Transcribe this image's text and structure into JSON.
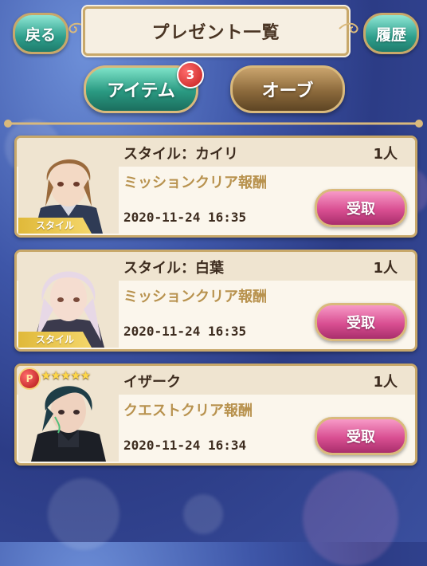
{
  "header": {
    "back_label": "戻る",
    "title": "プレゼント一覧",
    "history_label": "履歴"
  },
  "tabs": [
    {
      "label": "アイテム",
      "badge": "3",
      "active": true
    },
    {
      "label": "オーブ",
      "active": false
    }
  ],
  "presents": [
    {
      "name": "スタイル：カイリ",
      "quantity": "1人",
      "source": "ミッションクリア報酬",
      "date": "2020-11-24 16:35",
      "tag": "スタイル",
      "button": "受取"
    },
    {
      "name": "スタイル：白葉",
      "quantity": "1人",
      "source": "ミッションクリア報酬",
      "date": "2020-11-24 16:35",
      "tag": "スタイル",
      "button": "受取"
    },
    {
      "name": "イザーク",
      "quantity": "1人",
      "source": "クエストクリア報酬",
      "date": "2020-11-24 16:34",
      "rarity": "P",
      "stars": "★★★★★",
      "button": "受取"
    }
  ],
  "colors": {
    "accent_teal": "#2a9a82",
    "accent_gold": "#c8a86a",
    "receive_pink": "#d94f92",
    "reward_text": "#b8924e"
  }
}
